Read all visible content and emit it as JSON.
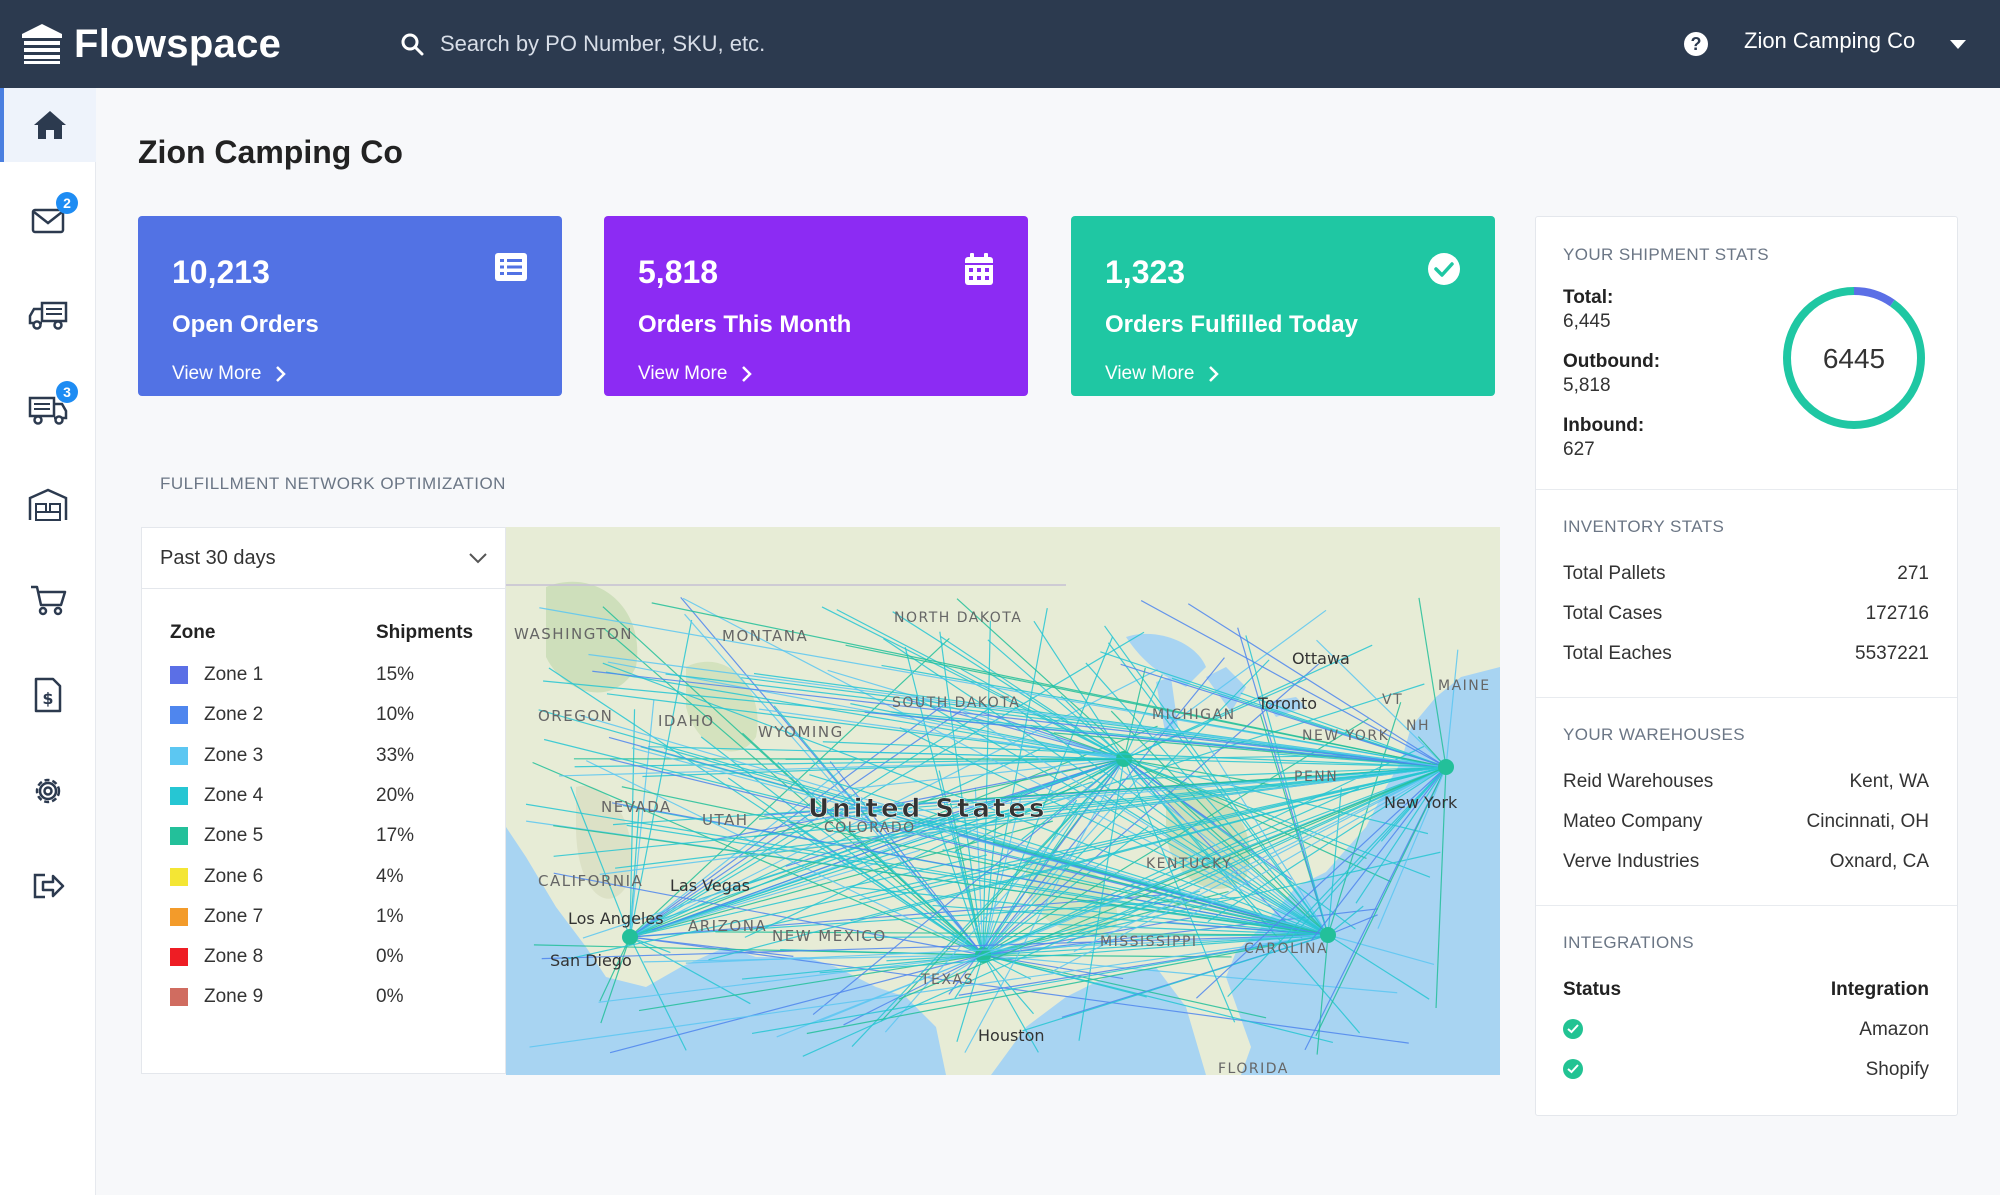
{
  "header": {
    "app_name": "Flowspace",
    "search_placeholder": "Search by PO Number, SKU, etc.",
    "help_glyph": "?",
    "account_name": "Zion Camping Co"
  },
  "sidebar": {
    "items": [
      {
        "icon": "home-icon",
        "active": true
      },
      {
        "icon": "mail-icon",
        "badge": "2"
      },
      {
        "icon": "truck-icon"
      },
      {
        "icon": "shipping-truck-icon",
        "badge": "3"
      },
      {
        "icon": "warehouse-icon"
      },
      {
        "icon": "cart-icon"
      },
      {
        "icon": "invoice-icon"
      },
      {
        "icon": "gear-icon"
      },
      {
        "icon": "logout-icon"
      }
    ]
  },
  "page": {
    "title": "Zion Camping Co"
  },
  "cards": [
    {
      "value": "10,213",
      "label": "Open Orders",
      "link": "View More",
      "color": "#5272e4",
      "icon": "list-icon"
    },
    {
      "value": "5,818",
      "label": "Orders This Month",
      "link": "View More",
      "color": "#8c2bf3",
      "icon": "calendar-icon"
    },
    {
      "value": "1,323",
      "label": "Orders Fulfilled Today",
      "link": "View More",
      "color": "#1fc7a3",
      "icon": "check-circle-icon"
    }
  ],
  "network": {
    "section_label": "FULFILLMENT NETWORK OPTIMIZATION",
    "range_value": "Past 30 days",
    "col_zone": "Zone",
    "col_shipments": "Shipments",
    "zones": [
      {
        "name": "Zone 1",
        "pct": "15%",
        "color": "#5b6fe6"
      },
      {
        "name": "Zone 2",
        "pct": "10%",
        "color": "#4f86ee"
      },
      {
        "name": "Zone 3",
        "pct": "33%",
        "color": "#5cc7f2"
      },
      {
        "name": "Zone 4",
        "pct": "20%",
        "color": "#26c6d3"
      },
      {
        "name": "Zone 5",
        "pct": "17%",
        "color": "#23c09a"
      },
      {
        "name": "Zone 6",
        "pct": "4%",
        "color": "#f4e634"
      },
      {
        "name": "Zone 7",
        "pct": "1%",
        "color": "#f39b2a"
      },
      {
        "name": "Zone 8",
        "pct": "0%",
        "color": "#ee1d24"
      },
      {
        "name": "Zone 9",
        "pct": "0%",
        "color": "#d06c60"
      }
    ],
    "map_labels": {
      "country": "United States",
      "washington": "WASHINGTON",
      "montana": "MONTANA",
      "north_dakota": "NORTH DAKOTA",
      "oregon": "OREGON",
      "idaho": "IDAHO",
      "wyoming": "WYOMING",
      "south_dakota": "SOUTH DAKOTA",
      "nevada": "NEVADA",
      "utah": "UTAH",
      "colorado": "COLORADO",
      "california": "CALIFORNIA",
      "arizona": "ARIZONA",
      "new_mexico": "NEW MEXICO",
      "texas": "TEXAS",
      "maine": "MAINE",
      "vt": "VT",
      "nh": "NH",
      "new_york_state": "NEW YORK",
      "michigan": "MICHIGAN",
      "penn": "PENN",
      "kentucky": "KENTUCKY",
      "mississippi": "MISSISSIPPI",
      "carolina": "CAROLINA",
      "florida": "FLORIDA",
      "las_vegas": "Las Vegas",
      "los_angeles": "Los Angeles",
      "san_diego": "San Diego",
      "houston": "Houston",
      "ottawa": "Ottawa",
      "toronto": "Toronto",
      "new_york": "New York"
    }
  },
  "shipment_stats": {
    "title": "YOUR SHIPMENT STATS",
    "total_label": "Total:",
    "total_value": "6,445",
    "outbound_label": "Outbound:",
    "outbound_value": "5,818",
    "inbound_label": "Inbound:",
    "inbound_value": "627",
    "ring_value": "6445",
    "ring_fraction_outbound": 0.903,
    "ring_colors": {
      "outbound": "#1fc7a3",
      "inbound": "#5b6fe6"
    }
  },
  "inventory": {
    "title": "INVENTORY STATS",
    "rows": [
      {
        "label": "Total Pallets",
        "value": "271"
      },
      {
        "label": "Total Cases",
        "value": "172716"
      },
      {
        "label": "Total Eaches",
        "value": "5537221"
      }
    ]
  },
  "warehouses": {
    "title": "YOUR WAREHOUSES",
    "rows": [
      {
        "name": "Reid Warehouses",
        "location": "Kent, WA"
      },
      {
        "name": "Mateo Company",
        "location": "Cincinnati, OH"
      },
      {
        "name": "Verve Industries",
        "location": "Oxnard, CA"
      }
    ]
  },
  "integrations": {
    "title": "INTEGRATIONS",
    "col_status": "Status",
    "col_integration": "Integration",
    "rows": [
      {
        "name": "Amazon"
      },
      {
        "name": "Shopify"
      }
    ]
  }
}
